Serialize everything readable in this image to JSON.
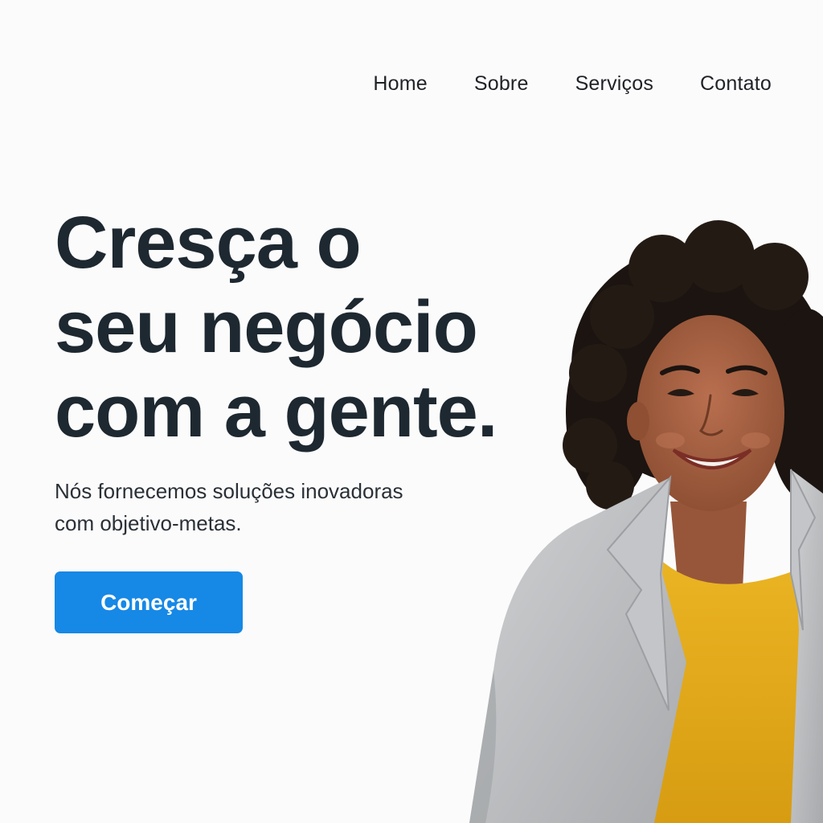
{
  "nav": {
    "items": [
      {
        "label": "Home"
      },
      {
        "label": "Sobre"
      },
      {
        "label": "Serviços"
      },
      {
        "label": "Contato"
      }
    ]
  },
  "hero": {
    "headline_lines": [
      "Cresça o",
      "seu negócio",
      "com a gente."
    ],
    "subtitle_lines": [
      "Nós fornecemos soluções inovadoras",
      "com objetivo-metas."
    ],
    "cta_label": "Começar"
  },
  "colors": {
    "background": "#fbfbfc",
    "headline": "#1d2830",
    "cta": "#1688e6",
    "blazer": "#b9bbbd",
    "shirt": "#e4ac1c"
  },
  "portrait": {
    "description_icon": "smiling-woman-photo"
  }
}
